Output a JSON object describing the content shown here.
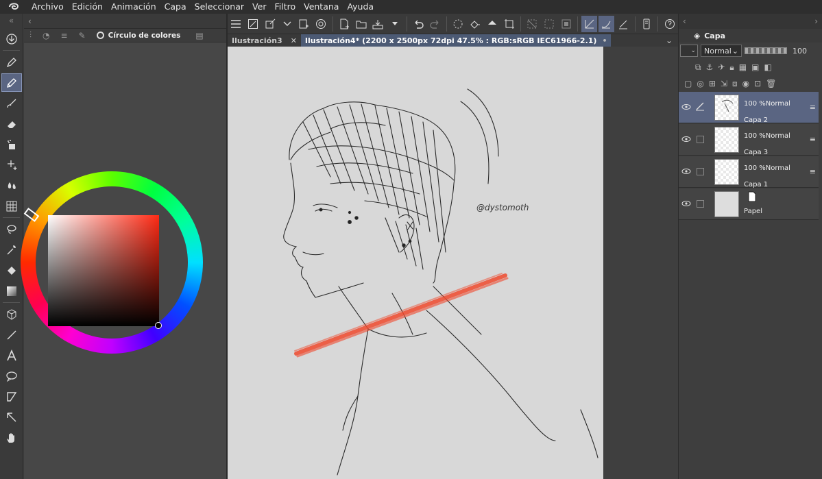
{
  "menu": [
    "Archivo",
    "Edición",
    "Animación",
    "Capa",
    "Seleccionar",
    "Ver",
    "Filtro",
    "Ventana",
    "Ayuda"
  ],
  "color_panel": {
    "tab_label": "Círculo de colores",
    "selected_hue": "#ff2a14"
  },
  "tools": [
    {
      "icon": "download-icon",
      "selected": false
    },
    {
      "icon": "pen-icon",
      "selected": false
    },
    {
      "icon": "pencil-icon",
      "selected": true
    },
    {
      "icon": "brush-icon",
      "selected": false
    },
    {
      "icon": "eraser-icon",
      "selected": false
    },
    {
      "icon": "airbrush-icon",
      "selected": false
    },
    {
      "icon": "sparkle-icon",
      "selected": false
    },
    {
      "icon": "blend-icon",
      "selected": false
    },
    {
      "icon": "grid-icon",
      "selected": false
    },
    {
      "icon": "lasso-icon",
      "selected": false
    },
    {
      "icon": "magic-wand-icon",
      "selected": false
    },
    {
      "icon": "fill-icon",
      "selected": false
    },
    {
      "icon": "gradient-icon",
      "selected": false
    },
    {
      "icon": "cube-icon",
      "selected": false
    },
    {
      "icon": "line-icon",
      "selected": false
    },
    {
      "icon": "text-icon",
      "selected": false
    },
    {
      "icon": "balloon-icon",
      "selected": false
    },
    {
      "icon": "frame-icon",
      "selected": false
    },
    {
      "icon": "move-icon",
      "selected": false
    },
    {
      "icon": "hand-icon",
      "selected": false
    }
  ],
  "documents": {
    "tab1": "Ilustración3",
    "tab2": "Ilustración4* (2200 x 2500px 72dpi 47.5% : RGB:sRGB IEC61966-2.1)"
  },
  "canvas": {
    "watermark": "@dystomoth"
  },
  "layer_panel": {
    "title": "Capa",
    "blend_mode": "Normal",
    "opacity": "100",
    "layers": [
      {
        "opacity_mode": "100 %Normal",
        "name": "Capa 2",
        "selected": true,
        "editing": true,
        "thumb": "sketch"
      },
      {
        "opacity_mode": "100 %Normal",
        "name": "Capa 3",
        "selected": false,
        "editing": false,
        "thumb": "transparent"
      },
      {
        "opacity_mode": "100 %Normal",
        "name": "Capa 1",
        "selected": false,
        "editing": false,
        "thumb": "transparent"
      },
      {
        "opacity_mode": "",
        "name": "Papel",
        "selected": false,
        "editing": false,
        "thumb": "paper"
      }
    ]
  }
}
